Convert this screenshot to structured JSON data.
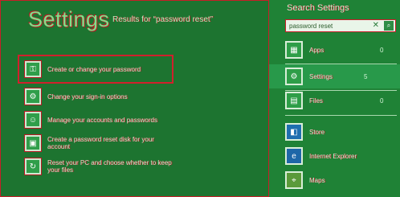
{
  "left": {
    "title": "Settings",
    "results_for": "Results for “password reset”",
    "results": [
      {
        "text": "Create or change your password",
        "icon": "key-icon",
        "selected": true
      },
      {
        "text": "Change your sign-in options",
        "icon": "gear-icon",
        "selected": false
      },
      {
        "text": "Manage your accounts and passwords",
        "icon": "person-icon",
        "selected": false
      },
      {
        "text": "Create a password reset disk for your account",
        "icon": "disk-icon",
        "selected": false
      },
      {
        "text": "Reset your PC and choose whether to keep your files",
        "icon": "reset-icon",
        "selected": false
      }
    ]
  },
  "right": {
    "header": "Search Settings",
    "search_value": "password reset",
    "categories": [
      {
        "label": "Apps",
        "count": "0",
        "icon": "apps-icon"
      },
      {
        "label": "Settings",
        "count": "5",
        "icon": "settings-icon"
      },
      {
        "label": "Files",
        "count": "0",
        "icon": "files-icon"
      },
      {
        "label": "Store",
        "icon": "store-icon"
      },
      {
        "label": "Internet Explorer",
        "icon": "ie-icon"
      },
      {
        "label": "Maps",
        "icon": "maps-icon"
      }
    ]
  }
}
